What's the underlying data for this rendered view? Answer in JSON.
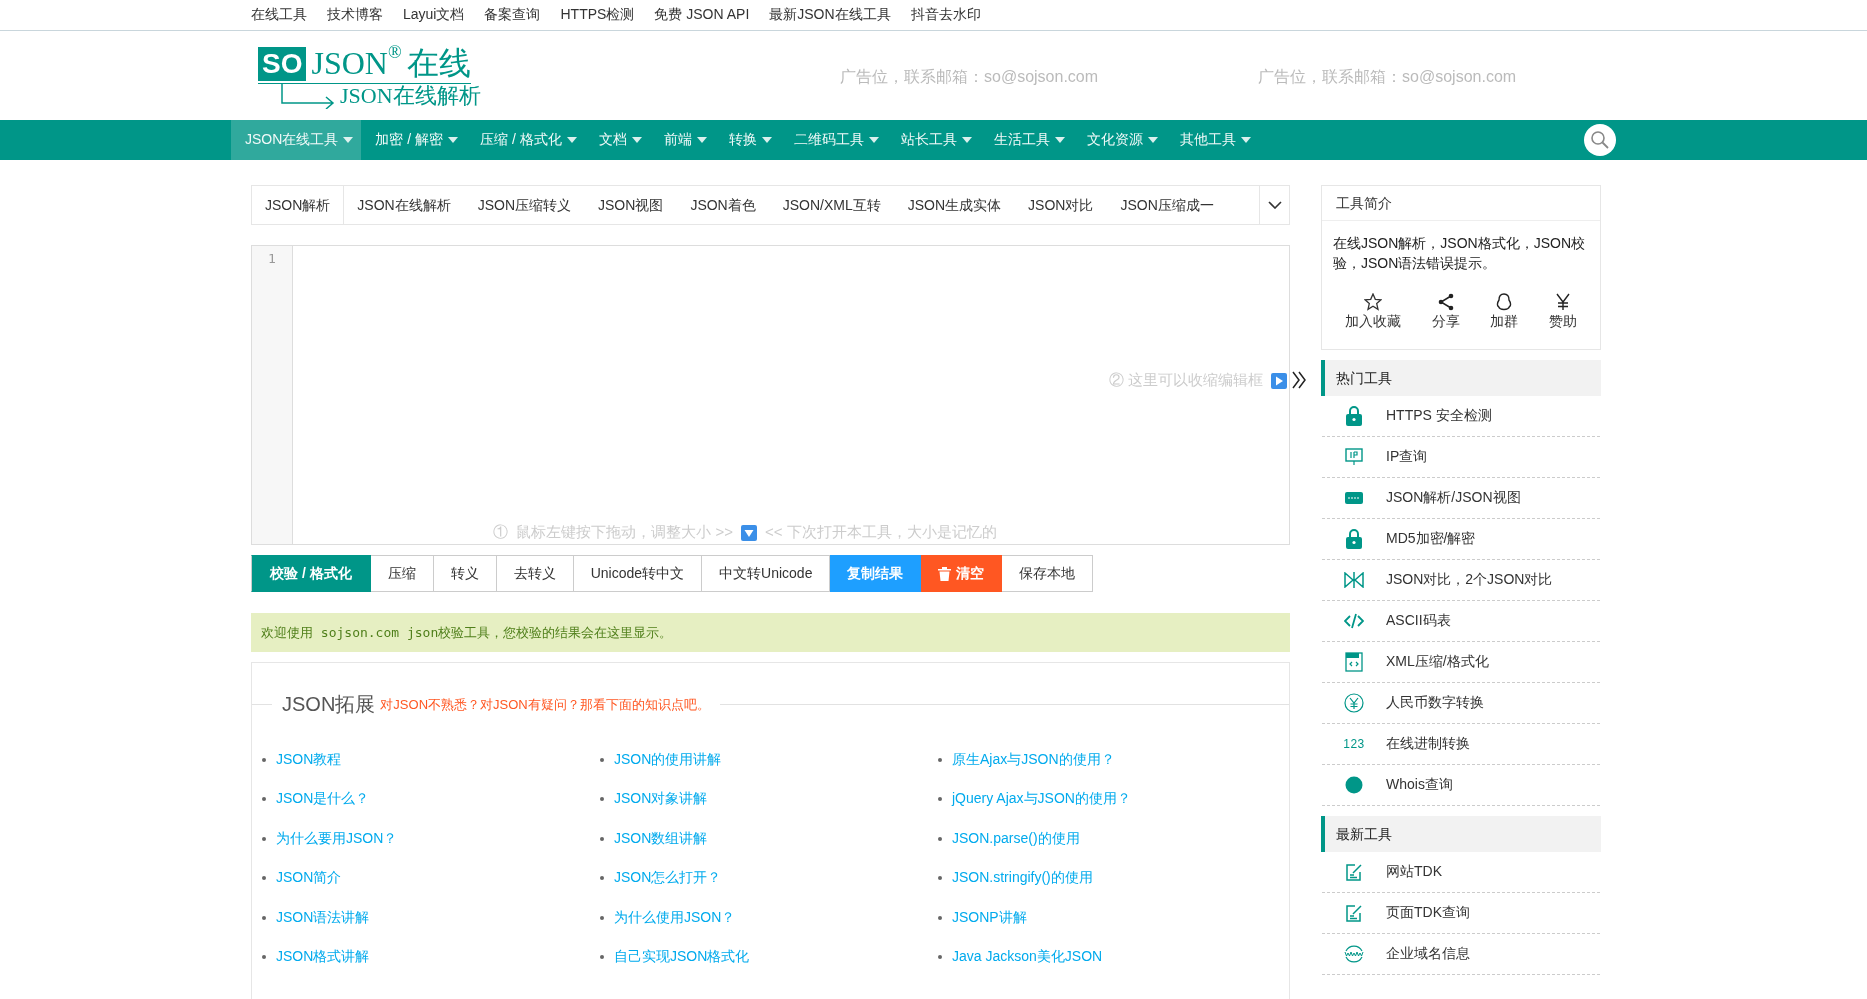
{
  "top_links": [
    "在线工具",
    "技术博客",
    "Layui文档",
    "备案查询",
    "HTTPS检测",
    "免费 JSON API",
    "最新JSON在线工具",
    "抖音去水印"
  ],
  "logo": {
    "badge": "SO",
    "name": "JSON",
    "mark": "®",
    "suffix": "在线",
    "subtitle": "JSON在线解析"
  },
  "ads": [
    "广告位，联系邮箱：so@sojson.com",
    "广告位，联系邮箱：so@sojson.com"
  ],
  "nav": [
    {
      "label": "JSON在线工具",
      "selected": true
    },
    {
      "label": "加密 / 解密",
      "selected": false
    },
    {
      "label": "压缩 / 格式化",
      "selected": false
    },
    {
      "label": "文档",
      "selected": false
    },
    {
      "label": "前端",
      "selected": false
    },
    {
      "label": "转换",
      "selected": false
    },
    {
      "label": "二维码工具",
      "selected": false
    },
    {
      "label": "站长工具",
      "selected": false
    },
    {
      "label": "生活工具",
      "selected": false
    },
    {
      "label": "文化资源",
      "selected": false
    },
    {
      "label": "其他工具",
      "selected": false
    }
  ],
  "tabs": [
    {
      "label": "JSON解析",
      "selected": true
    },
    {
      "label": "JSON在线解析",
      "selected": false
    },
    {
      "label": "JSON压缩转义",
      "selected": false
    },
    {
      "label": "JSON视图",
      "selected": false
    },
    {
      "label": "JSON着色",
      "selected": false
    },
    {
      "label": "JSON/XML互转",
      "selected": false
    },
    {
      "label": "JSON生成实体",
      "selected": false
    },
    {
      "label": "JSON对比",
      "selected": false
    },
    {
      "label": "JSON压缩成一",
      "selected": false
    }
  ],
  "editor": {
    "line_number": "1",
    "collapse_hint": "② 这里可以收缩编辑框",
    "resize_hint": "①  鼠标左键按下拖动，调整大小 >>",
    "remember_hint": "<< 下次打开本工具，大小是记忆的"
  },
  "buttons": [
    {
      "label": "校验 / 格式化",
      "kind": "primary"
    },
    {
      "label": "压缩",
      "kind": "default"
    },
    {
      "label": "转义",
      "kind": "default"
    },
    {
      "label": "去转义",
      "kind": "default"
    },
    {
      "label": "Unicode转中文",
      "kind": "default"
    },
    {
      "label": "中文转Unicode",
      "kind": "default"
    },
    {
      "label": "复制结果",
      "kind": "info"
    },
    {
      "label": "清空",
      "kind": "danger"
    },
    {
      "label": "保存本地",
      "kind": "default"
    }
  ],
  "message": "欢迎使用 sojson.com json校验工具，您校验的结果会在这里显示。",
  "knowledge": {
    "title": "JSON拓展",
    "subtitle": "对JSON不熟悉？对JSON有疑问？那看下面的知识点吧。",
    "columns": [
      [
        "JSON教程",
        "JSON是什么？",
        "为什么要用JSON？",
        "JSON简介",
        "JSON语法讲解",
        "JSON格式讲解"
      ],
      [
        "JSON的使用讲解",
        "JSON对象讲解",
        "JSON数组讲解",
        "JSON怎么打开？",
        "为什么使用JSON？",
        "自己实现JSON格式化"
      ],
      [
        "原生Ajax与JSON的使用？",
        "jQuery Ajax与JSON的使用？",
        "JSON.parse()的使用",
        "JSON.stringify()的使用",
        "JSONP讲解",
        "Java Jackson美化JSON"
      ]
    ]
  },
  "intro": {
    "title": "工具简介",
    "text": "在线JSON解析，JSON格式化，JSON校验，JSON语法错误提示。",
    "actions": [
      {
        "label": "加入收藏",
        "kind": "star"
      },
      {
        "label": "分享",
        "kind": "share"
      },
      {
        "label": "加群",
        "kind": "chat"
      },
      {
        "label": "赞助",
        "kind": "yen"
      }
    ]
  },
  "sections": [
    {
      "title": "热门工具",
      "items": [
        {
          "label": "HTTPS 安全检测",
          "kind": "lock"
        },
        {
          "label": "IP查询",
          "kind": "sign"
        },
        {
          "label": "JSON解析/JSON视图",
          "kind": "json"
        },
        {
          "label": "MD5加密/解密",
          "kind": "lock"
        },
        {
          "label": "JSON对比，2个JSON对比",
          "kind": "compare"
        },
        {
          "label": "ASCII码表",
          "kind": "code"
        },
        {
          "label": "XML压缩/格式化",
          "kind": "file"
        },
        {
          "label": "人民币数字转换",
          "kind": "coin"
        },
        {
          "label": "在线进制转换",
          "kind": "number",
          "icon_text": "123"
        },
        {
          "label": "Whois查询",
          "kind": "globe"
        }
      ]
    },
    {
      "title": "最新工具",
      "items": [
        {
          "label": "网站TDK",
          "kind": "edit"
        },
        {
          "label": "页面TDK查询",
          "kind": "edit"
        },
        {
          "label": "企业域名信息",
          "kind": "web"
        }
      ]
    }
  ]
}
